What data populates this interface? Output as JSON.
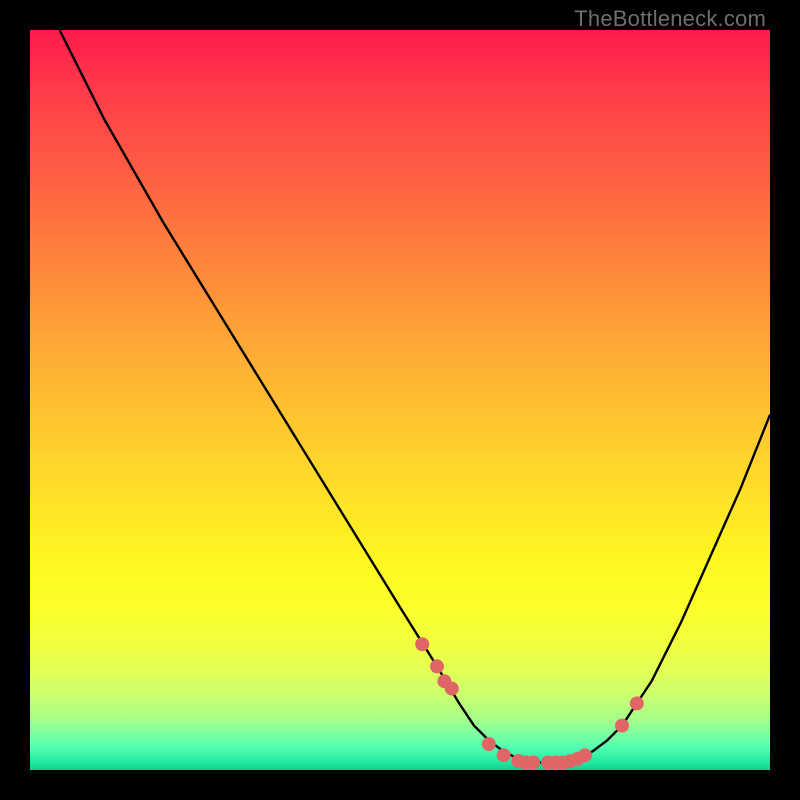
{
  "watermark": "TheBottleneck.com",
  "chart_data": {
    "type": "line",
    "title": "",
    "xlabel": "",
    "ylabel": "",
    "xlim": [
      0,
      100
    ],
    "ylim": [
      0,
      100
    ],
    "series": [
      {
        "name": "bottleneck-curve",
        "x": [
          4,
          10,
          18,
          26,
          34,
          42,
          50,
          55,
          58,
          60,
          62,
          64,
          66,
          68,
          70,
          72,
          74,
          76,
          78,
          80,
          84,
          88,
          92,
          96,
          100
        ],
        "y": [
          100,
          88,
          74,
          61,
          48,
          35,
          22,
          14,
          9,
          6,
          4,
          2.5,
          1.5,
          1,
          1,
          1,
          1.5,
          2.5,
          4,
          6,
          12,
          20,
          29,
          38,
          48
        ]
      }
    ],
    "markers": {
      "name": "sample-points",
      "x": [
        53,
        55,
        56,
        57,
        62,
        64,
        66,
        67,
        68,
        70,
        71,
        72,
        73,
        74,
        75,
        80,
        82
      ],
      "y": [
        17,
        14,
        12,
        11,
        3.5,
        2,
        1.2,
        1,
        1,
        1,
        1,
        1,
        1.2,
        1.5,
        2,
        6,
        9
      ]
    },
    "colors": {
      "curve": "#000000",
      "markers": "#e06666"
    }
  }
}
